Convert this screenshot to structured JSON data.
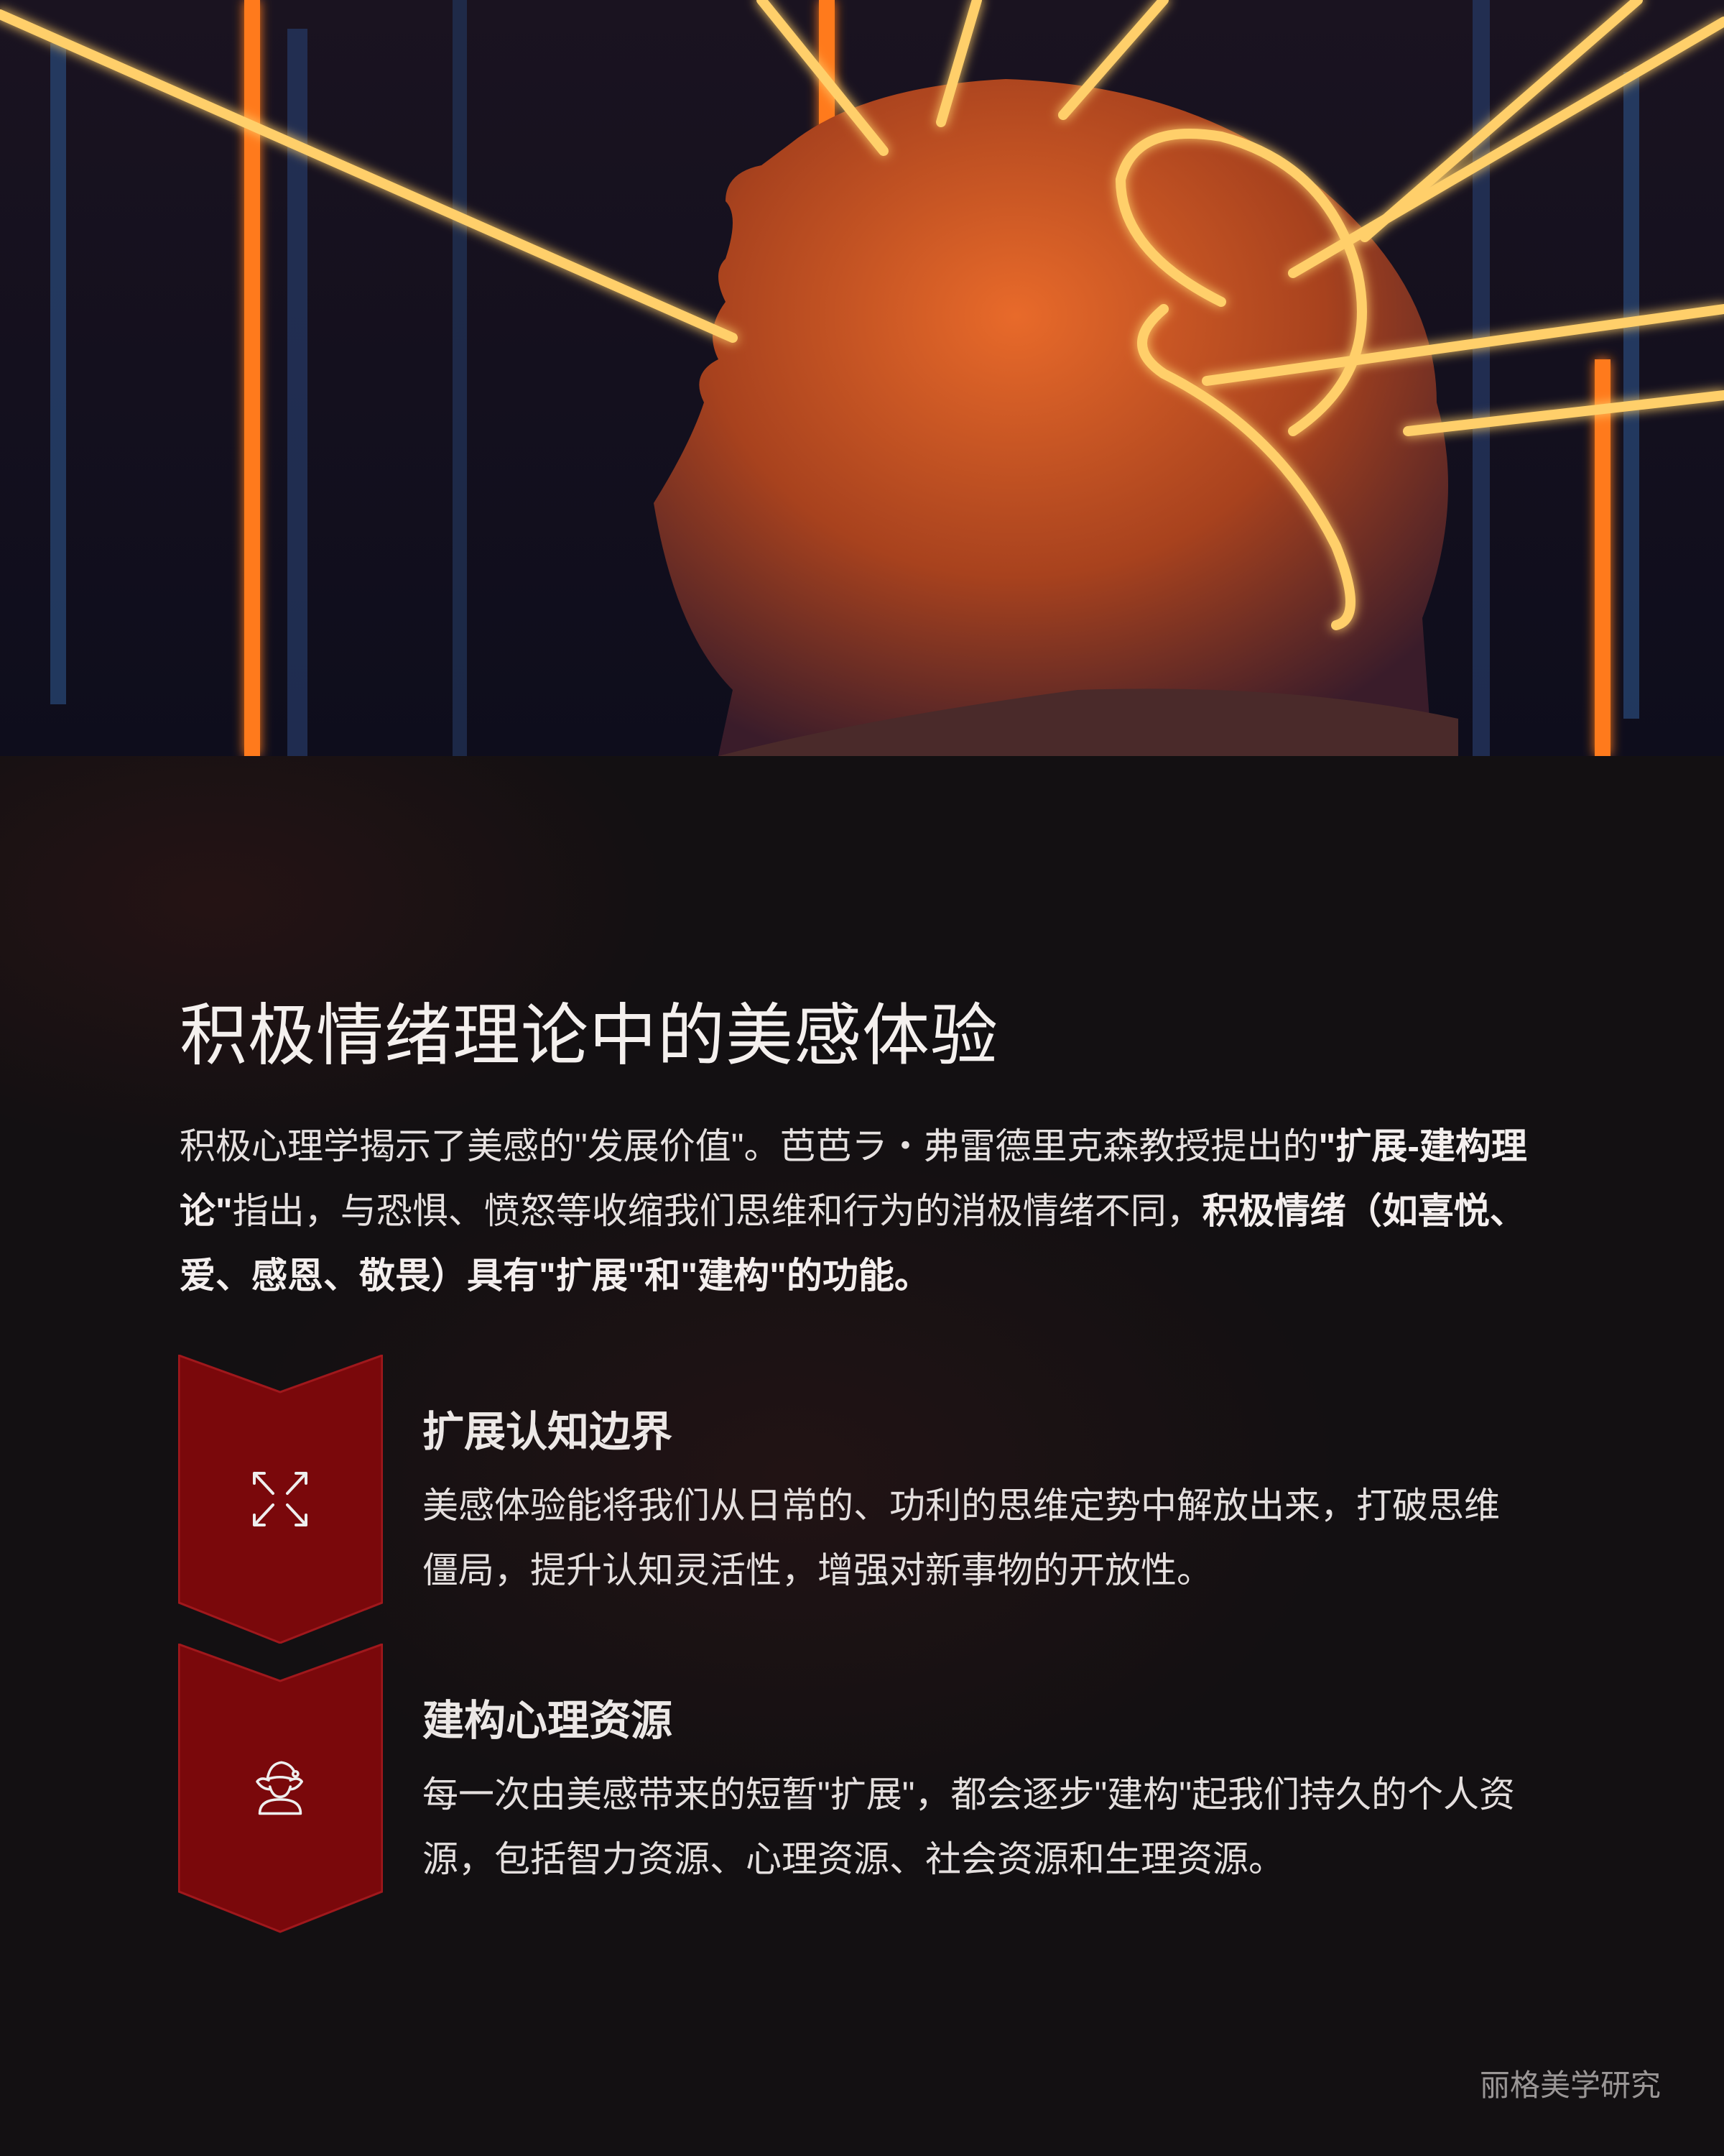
{
  "hero": {
    "image": "woman-face-neon-lines-photo",
    "accent": "#ff8a1e"
  },
  "title": "积极情绪理论中的美感体验",
  "intro": {
    "p1": "积极心理学揭示了美感的\"发展价值\"。芭芭ラ・弗雷德里克森教授提出的",
    "b1": "\"扩展-建构理论\"",
    "p2": "指出，与恐惧、愤怒等收缩我们思维和行为的消极情绪不同，",
    "b2": "积极情绪（如喜悦、爱、感恩、敬畏）具有\"扩展\"和\"建构\"的功能。"
  },
  "cards": [
    {
      "icon": "expand-arrows-icon",
      "title": "扩展认知边界",
      "body": "美感体验能将我们从日常的、功利的思维定势中解放出来，打破思维僵局，提升认知灵活性，增强对新事物的开放性。"
    },
    {
      "icon": "elf-person-icon",
      "title": "建构心理资源",
      "body": "每一次由美感带来的短暂\"扩展\"，都会逐步\"建构\"起我们持久的个人资源，包括智力资源、心理资源、社会资源和生理资源。"
    }
  ],
  "colors": {
    "chevron": "#7a080b",
    "chevron_border": "#a0181c",
    "background": "#131012"
  },
  "footer": "丽格美学研究"
}
